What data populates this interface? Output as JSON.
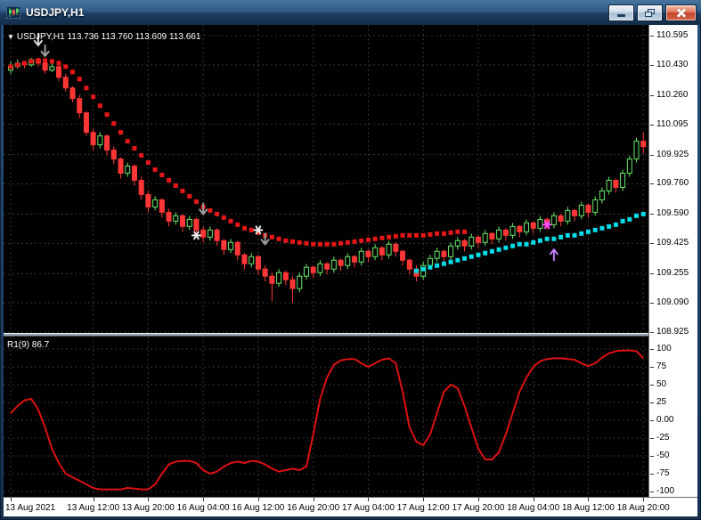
{
  "window": {
    "title": "USDJPY,H1",
    "controls": {
      "minimize": "minimize",
      "restore": "restore",
      "close": "close"
    }
  },
  "chart_data": {
    "type": "candlestick",
    "header": {
      "dropdown": "▼",
      "symbol": "USDJPY,H1",
      "ohlc": "113.736 113.760 113.609 113.661"
    },
    "ylim": [
      108.92,
      110.655
    ],
    "price_ticks": [
      "110.595",
      "110.430",
      "110.260",
      "110.095",
      "109.925",
      "109.760",
      "109.590",
      "109.425",
      "109.255",
      "109.090",
      "108.925"
    ],
    "time_ticks": [
      {
        "bar": 0,
        "label": "13 Aug 2021"
      },
      {
        "bar": 12,
        "label": "13 Aug 12:00"
      },
      {
        "bar": 20,
        "label": "13 Aug 20:00"
      },
      {
        "bar": 28,
        "label": "16 Aug 04:00"
      },
      {
        "bar": 36,
        "label": "16 Aug 12:00"
      },
      {
        "bar": 44,
        "label": "16 Aug 20:00"
      },
      {
        "bar": 52,
        "label": "17 Aug 04:00"
      },
      {
        "bar": 60,
        "label": "17 Aug 12:00"
      },
      {
        "bar": 68,
        "label": "17 Aug 20:00"
      },
      {
        "bar": 76,
        "label": "18 Aug 04:00"
      },
      {
        "bar": 84,
        "label": "18 Aug 12:00"
      },
      {
        "bar": 92,
        "label": "18 Aug 20:00"
      }
    ],
    "colors": {
      "bull": "#69e869",
      "bear": "#ff3636",
      "red_dots": "#e81717",
      "cyan_dots": "#00dde8",
      "indicator": "#dd1111",
      "grid": "#353535",
      "background": "#000000",
      "axis_bg": "#ffffff",
      "axis_text": "#000000"
    },
    "candles": [
      [
        110.4,
        110.45,
        110.38,
        110.42
      ],
      [
        110.42,
        110.46,
        110.41,
        110.44
      ],
      [
        110.44,
        110.45,
        110.41,
        110.43
      ],
      [
        110.43,
        110.47,
        110.42,
        110.46
      ],
      [
        110.46,
        110.47,
        110.42,
        110.44
      ],
      [
        110.44,
        110.45,
        110.38,
        110.4
      ],
      [
        110.4,
        110.44,
        110.39,
        110.42
      ],
      [
        110.42,
        110.43,
        110.34,
        110.36
      ],
      [
        110.36,
        110.38,
        110.28,
        110.3
      ],
      [
        110.3,
        110.31,
        110.22,
        110.24
      ],
      [
        110.24,
        110.26,
        110.13,
        110.16
      ],
      [
        110.16,
        110.17,
        110.03,
        110.05
      ],
      [
        110.05,
        110.07,
        109.95,
        109.98
      ],
      [
        109.98,
        110.05,
        109.96,
        110.03
      ],
      [
        110.03,
        110.04,
        109.92,
        109.95
      ],
      [
        109.95,
        109.97,
        109.87,
        109.9
      ],
      [
        109.9,
        109.91,
        109.79,
        109.82
      ],
      [
        109.82,
        109.88,
        109.8,
        109.86
      ],
      [
        109.86,
        109.87,
        109.75,
        109.78
      ],
      [
        109.78,
        109.8,
        109.67,
        109.7
      ],
      [
        109.7,
        109.72,
        109.6,
        109.63
      ],
      [
        109.63,
        109.69,
        109.61,
        109.67
      ],
      [
        109.67,
        109.68,
        109.57,
        109.6
      ],
      [
        109.6,
        109.62,
        109.52,
        109.55
      ],
      [
        109.55,
        109.6,
        109.53,
        109.58
      ],
      [
        109.58,
        109.59,
        109.49,
        109.52
      ],
      [
        109.52,
        109.58,
        109.5,
        109.56
      ],
      [
        109.56,
        109.57,
        109.47,
        109.5
      ],
      [
        109.5,
        109.52,
        109.43,
        109.46
      ],
      [
        109.46,
        109.52,
        109.44,
        109.5
      ],
      [
        109.5,
        109.51,
        109.41,
        109.44
      ],
      [
        109.44,
        109.45,
        109.36,
        109.39
      ],
      [
        109.39,
        109.45,
        109.37,
        109.43
      ],
      [
        109.43,
        109.44,
        109.33,
        109.36
      ],
      [
        109.36,
        109.37,
        109.28,
        109.31
      ],
      [
        109.31,
        109.37,
        109.29,
        109.35
      ],
      [
        109.35,
        109.36,
        109.25,
        109.28
      ],
      [
        109.28,
        109.3,
        109.21,
        109.24
      ],
      [
        109.24,
        109.26,
        109.1,
        109.2
      ],
      [
        109.2,
        109.28,
        109.18,
        109.26
      ],
      [
        109.26,
        109.27,
        109.19,
        109.22
      ],
      [
        109.22,
        109.24,
        109.09,
        109.17
      ],
      [
        109.17,
        109.26,
        109.15,
        109.24
      ],
      [
        109.24,
        109.31,
        109.22,
        109.29
      ],
      [
        109.29,
        109.3,
        109.23,
        109.26
      ],
      [
        109.26,
        109.33,
        109.24,
        109.31
      ],
      [
        109.31,
        109.32,
        109.25,
        109.28
      ],
      [
        109.28,
        109.35,
        109.26,
        109.33
      ],
      [
        109.33,
        109.34,
        109.27,
        109.3
      ],
      [
        109.3,
        109.37,
        109.28,
        109.35
      ],
      [
        109.35,
        109.36,
        109.29,
        109.32
      ],
      [
        109.32,
        109.4,
        109.3,
        109.38
      ],
      [
        109.38,
        109.39,
        109.32,
        109.35
      ],
      [
        109.35,
        109.42,
        109.33,
        109.4
      ],
      [
        109.4,
        109.41,
        109.33,
        109.36
      ],
      [
        109.36,
        109.44,
        109.34,
        109.42
      ],
      [
        109.42,
        109.43,
        109.35,
        109.38
      ],
      [
        109.38,
        109.39,
        109.3,
        109.33
      ],
      [
        109.33,
        109.34,
        109.25,
        109.28
      ],
      [
        109.28,
        109.3,
        109.21,
        109.24
      ],
      [
        109.24,
        109.32,
        109.22,
        109.3
      ],
      [
        109.3,
        109.36,
        109.28,
        109.34
      ],
      [
        109.34,
        109.4,
        109.32,
        109.38
      ],
      [
        109.38,
        109.39,
        109.32,
        109.35
      ],
      [
        109.35,
        109.43,
        109.33,
        109.41
      ],
      [
        109.41,
        109.46,
        109.39,
        109.44
      ],
      [
        109.44,
        109.45,
        109.38,
        109.41
      ],
      [
        109.41,
        109.48,
        109.39,
        109.46
      ],
      [
        109.46,
        109.47,
        109.4,
        109.43
      ],
      [
        109.43,
        109.5,
        109.41,
        109.48
      ],
      [
        109.48,
        109.49,
        109.42,
        109.45
      ],
      [
        109.45,
        109.52,
        109.43,
        109.5
      ],
      [
        109.5,
        109.51,
        109.44,
        109.47
      ],
      [
        109.47,
        109.54,
        109.45,
        109.52
      ],
      [
        109.52,
        109.53,
        109.46,
        109.49
      ],
      [
        109.49,
        109.56,
        109.47,
        109.54
      ],
      [
        109.54,
        109.55,
        109.48,
        109.51
      ],
      [
        109.51,
        109.58,
        109.49,
        109.56
      ],
      [
        109.56,
        109.57,
        109.5,
        109.53
      ],
      [
        109.53,
        109.6,
        109.51,
        109.58
      ],
      [
        109.58,
        109.59,
        109.52,
        109.55
      ],
      [
        109.55,
        109.63,
        109.53,
        109.61
      ],
      [
        109.61,
        109.62,
        109.55,
        109.58
      ],
      [
        109.58,
        109.66,
        109.56,
        109.64
      ],
      [
        109.64,
        109.65,
        109.57,
        109.6
      ],
      [
        109.6,
        109.69,
        109.58,
        109.67
      ],
      [
        109.67,
        109.74,
        109.65,
        109.72
      ],
      [
        109.72,
        109.8,
        109.7,
        109.78
      ],
      [
        109.78,
        109.79,
        109.71,
        109.74
      ],
      [
        109.74,
        109.84,
        109.72,
        109.82
      ],
      [
        109.82,
        109.92,
        109.8,
        109.9
      ],
      [
        109.9,
        110.02,
        109.88,
        110.0
      ],
      [
        110.0,
        110.05,
        109.93,
        109.97
      ]
    ],
    "overlays": [
      {
        "name": "red-dots-series",
        "color": "#e81717",
        "start_bar": 0,
        "values": [
          110.42,
          110.43,
          110.44,
          110.45,
          110.455,
          110.455,
          110.45,
          110.44,
          110.42,
          110.39,
          110.35,
          110.3,
          110.25,
          110.2,
          110.15,
          110.1,
          110.05,
          110.0,
          109.96,
          109.92,
          109.88,
          109.84,
          109.81,
          109.78,
          109.75,
          109.72,
          109.69,
          109.66,
          109.63,
          109.61,
          109.59,
          109.57,
          109.55,
          109.53,
          109.51,
          109.5,
          109.485,
          109.47,
          109.46,
          109.45,
          109.44,
          109.435,
          109.43,
          109.425,
          109.42,
          109.42,
          109.42,
          109.42,
          109.425,
          109.43,
          109.435,
          109.44,
          109.445,
          109.45,
          109.455,
          109.46,
          109.465,
          109.47,
          109.47,
          109.47,
          109.47,
          109.475,
          109.48,
          109.48,
          109.485,
          109.49,
          109.49
        ]
      },
      {
        "name": "cyan-dots-series",
        "color": "#00dde8",
        "start_bar": 59,
        "values": [
          109.27,
          109.28,
          109.29,
          109.3,
          109.31,
          109.32,
          109.33,
          109.34,
          109.35,
          109.36,
          109.37,
          109.38,
          109.39,
          109.4,
          109.41,
          109.42,
          109.42,
          109.43,
          109.44,
          109.45,
          109.45,
          109.46,
          109.47,
          109.47,
          109.48,
          109.49,
          109.5,
          109.51,
          109.52,
          109.53,
          109.55,
          109.56,
          109.58,
          109.59
        ]
      }
    ],
    "markers": [
      {
        "type": "arrow-down",
        "bar": 4,
        "price": 110.55,
        "color": "#d9d9d9"
      },
      {
        "type": "arrow-down",
        "bar": 5,
        "price": 110.49,
        "color": "#9e9e9e"
      },
      {
        "type": "star",
        "bar": 27,
        "price": 109.47,
        "color": "#e8e8e8"
      },
      {
        "type": "arrow-down",
        "bar": 28,
        "price": 109.6,
        "color": "#9e9e9e"
      },
      {
        "type": "star",
        "bar": 36,
        "price": 109.5,
        "color": "#e8e8e8"
      },
      {
        "type": "arrow-down",
        "bar": 37,
        "price": 109.43,
        "color": "#9e9e9e"
      },
      {
        "type": "star",
        "bar": 78,
        "price": 109.53,
        "color": "#ff4dff"
      },
      {
        "type": "arrow-up",
        "bar": 79,
        "price": 109.38,
        "color": "#c77dff"
      }
    ],
    "indicator": {
      "label": "R1(9) 86.7",
      "type": "line",
      "color": "#dd1111",
      "ylim": [
        -100,
        100
      ],
      "ticks": [
        "100",
        "75",
        "50",
        "25",
        "0.00",
        "-25",
        "-50",
        "-75",
        "-100"
      ],
      "values": [
        10,
        20,
        28,
        30,
        15,
        -10,
        -40,
        -60,
        -75,
        -80,
        -85,
        -90,
        -95,
        -97,
        -97,
        -97,
        -97,
        -95,
        -96,
        -97,
        -97,
        -90,
        -75,
        -62,
        -58,
        -57,
        -57,
        -60,
        -70,
        -75,
        -72,
        -65,
        -60,
        -58,
        -60,
        -57,
        -58,
        -62,
        -68,
        -72,
        -70,
        -68,
        -70,
        -65,
        -20,
        30,
        60,
        78,
        84,
        86,
        86,
        80,
        75,
        80,
        85,
        87,
        80,
        40,
        -10,
        -30,
        -35,
        -20,
        10,
        40,
        50,
        45,
        20,
        -10,
        -40,
        -55,
        -55,
        -45,
        -20,
        10,
        40,
        60,
        75,
        83,
        86,
        87,
        87,
        86,
        85,
        80,
        76,
        80,
        88,
        94,
        97,
        98,
        98,
        97,
        87
      ]
    }
  }
}
